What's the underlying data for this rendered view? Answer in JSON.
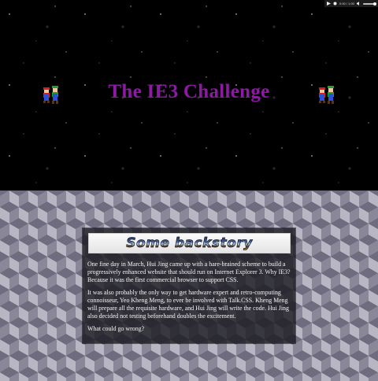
{
  "player": {
    "time": "0:00 / 1:00",
    "play_icon": "play-icon",
    "stop_icon": "stop-icon",
    "volume_icon": "volume-icon"
  },
  "hero": {
    "title": "The IE3 Challenge",
    "title_color": "#8c1aa3",
    "sprite_icon": "mario-luigi-sprite"
  },
  "backstory": {
    "heading": "Some backstory",
    "paragraphs": [
      "One fine day in March, Hui Jing came up with a hare-brained scheme to build a progressively enhanced website that should run on Internet Explorer 3. Why IE3? Because it was the first commercial browser to support CSS.",
      "It was also probably the only way to get hardware expert and retro-computing connoisseur, Yeo Kheng Meng, to ever be involved with Talk.CSS. Kheng Meng will prepare all the requisite hardware, and Hui Jing will write the code. Hui Jing also decided not testing beforehand doubles the excitement.",
      "What could go wrong?"
    ]
  }
}
